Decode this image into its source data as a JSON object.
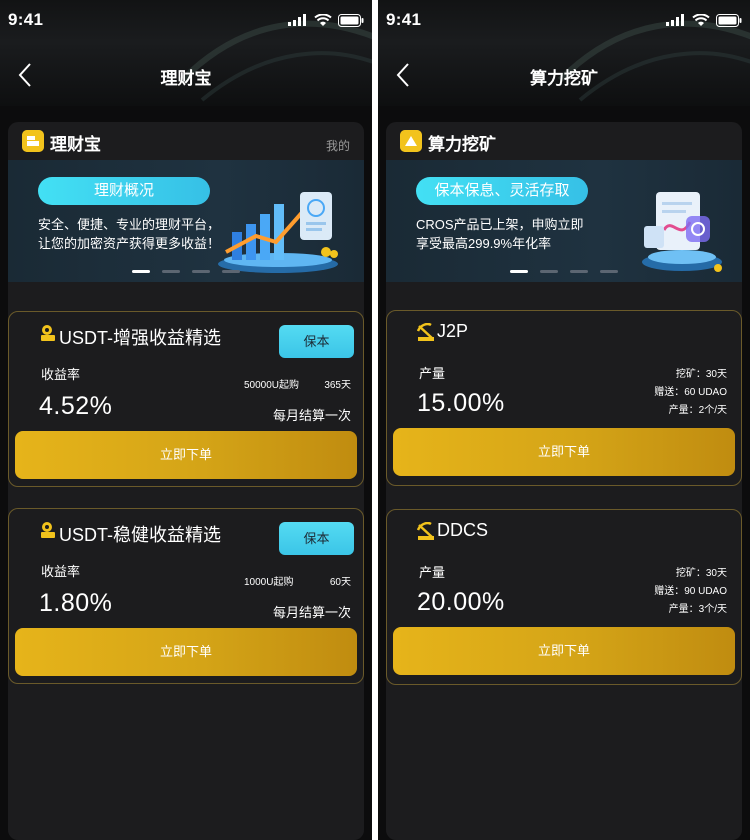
{
  "left": {
    "status_time": "9:41",
    "nav_title": "理财宝",
    "panel_title": "理财宝",
    "panel_link": "我的",
    "banner": {
      "pill": "理财概况",
      "line1": "安全、便捷、专业的理财平台，",
      "line2": "让您的加密资产获得更多收益！"
    },
    "products": [
      {
        "title": "USDT-增强收益精选",
        "tag": "保本",
        "rate_label": "收益率",
        "rate": "4.52%",
        "min": "50000U起购",
        "term": "365天",
        "settle": "每月结算一次",
        "order": "立即下单"
      },
      {
        "title": "USDT-稳健收益精选",
        "tag": "保本",
        "rate_label": "收益率",
        "rate": "1.80%",
        "min": "1000U起购",
        "term": "60天",
        "settle": "每月结算一次",
        "order": "立即下单"
      }
    ]
  },
  "right": {
    "status_time": "9:41",
    "nav_title": "算力挖矿",
    "panel_title": "算力挖矿",
    "banner": {
      "pill": "保本保息、灵活存取",
      "line1": "CROS产品已上架，申购立即",
      "line2": "享受最高299.9%年化率"
    },
    "products": [
      {
        "title": "J2P",
        "rate_label": "产量",
        "rate": "15.00%",
        "mining": "挖矿：30天",
        "gift": "赠送：60 UDAO",
        "output": "产量：2个/天",
        "order": "立即下单"
      },
      {
        "title": "DDCS",
        "rate_label": "产量",
        "rate": "20.00%",
        "mining": "挖矿：30天",
        "gift": "赠送：90 UDAO",
        "output": "产量：3个/天",
        "order": "立即下单"
      }
    ]
  },
  "colors": {
    "background": "#0c0c0d",
    "panel": "#1c1c1e",
    "accent_gold": "#d4a417",
    "accent_cyan": "#3bc5e7",
    "card_border": "#6a5a2a"
  },
  "icons": [
    "signal-icon",
    "wifi-icon",
    "battery-icon",
    "back-arrow-icon",
    "wallet-icon",
    "pickaxe-icon",
    "coin-icon",
    "chart-illustration",
    "document-illustration"
  ]
}
